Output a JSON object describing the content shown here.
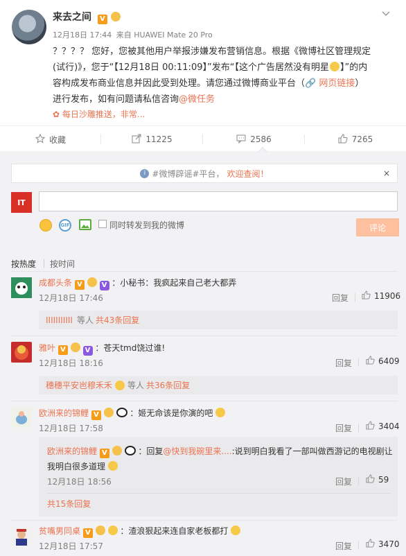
{
  "post": {
    "author": "来去之间",
    "date": "12月18日 17:44",
    "from_prefix": "来自",
    "device": "HUAWEI Mate 20 Pro",
    "content_line1": "？？？？ 您好，您被其他用户举报涉嫌发布营销信息。根据《微博社区管理规定",
    "content_line2": "(试行)》，您于“【12月18日 00:11:09】”发布“【这个广告居然没有明星",
    "content_line2b": "】”的内",
    "content_line3": "容构成发布商业信息并因此受到处理。请您通过微博商业平台（",
    "content_link": "网页链接",
    "content_line4a": "）",
    "content_line4": "进行发布，如有问题请私信咨询",
    "content_mention": "@微任务",
    "source_line": "每日沙雕推送，非常..."
  },
  "actions": {
    "favorite_label": "收藏",
    "repost_count": "11225",
    "comment_count": "2586",
    "like_count": "7265"
  },
  "notice": {
    "prefix": "#微博辟谣#平台，",
    "link": "欢迎查阅！",
    "close": "×"
  },
  "composer": {
    "logo_text": "IT",
    "sync_label": "同时转发到我的微博",
    "submit_label": "评论"
  },
  "sort": {
    "hot": "按热度",
    "time": "按时间"
  },
  "comments": [
    {
      "name": "成都头条",
      "text": "：小秘书：我疯起来自己老大都弄",
      "time": "12月18日 17:46",
      "reply_label": "回复",
      "likes": "11906",
      "sub_prefix": "IIIIIIIIIII",
      "sub_middle": "等人",
      "sub_link": "共43条回复"
    },
    {
      "name": "雅叶",
      "text": "：苍天tmd饶过谁!",
      "time": "12月18日 18:16",
      "reply_label": "回复",
      "likes": "6409",
      "sub_prefix": "穗穗平安岜穆禾禾",
      "sub_middle": "等人",
      "sub_link": "共36条回复"
    },
    {
      "name": "欧洲来的锦鲤",
      "text": "：姬无命该是你演的吧",
      "time": "12月18日 17:58",
      "reply_label": "回复",
      "likes": "3404",
      "nested": {
        "name": "欧洲来的锦鲤",
        "reply_word": "：回复",
        "mention": "@快到我碗里来....",
        "text": ":说到明白我看了一部叫做西游记的电视剧让",
        "text2": "我明白很多道理",
        "time": "12月18日 18:56",
        "reply_label": "回复",
        "likes": "59"
      },
      "sub_link": "共15条回复"
    },
    {
      "name": "贫嘴男同桌",
      "text": "：渣浪狠起来连自家老板都打",
      "time": "12月18日 17:57",
      "reply_label": "回复",
      "likes": "3470"
    }
  ]
}
